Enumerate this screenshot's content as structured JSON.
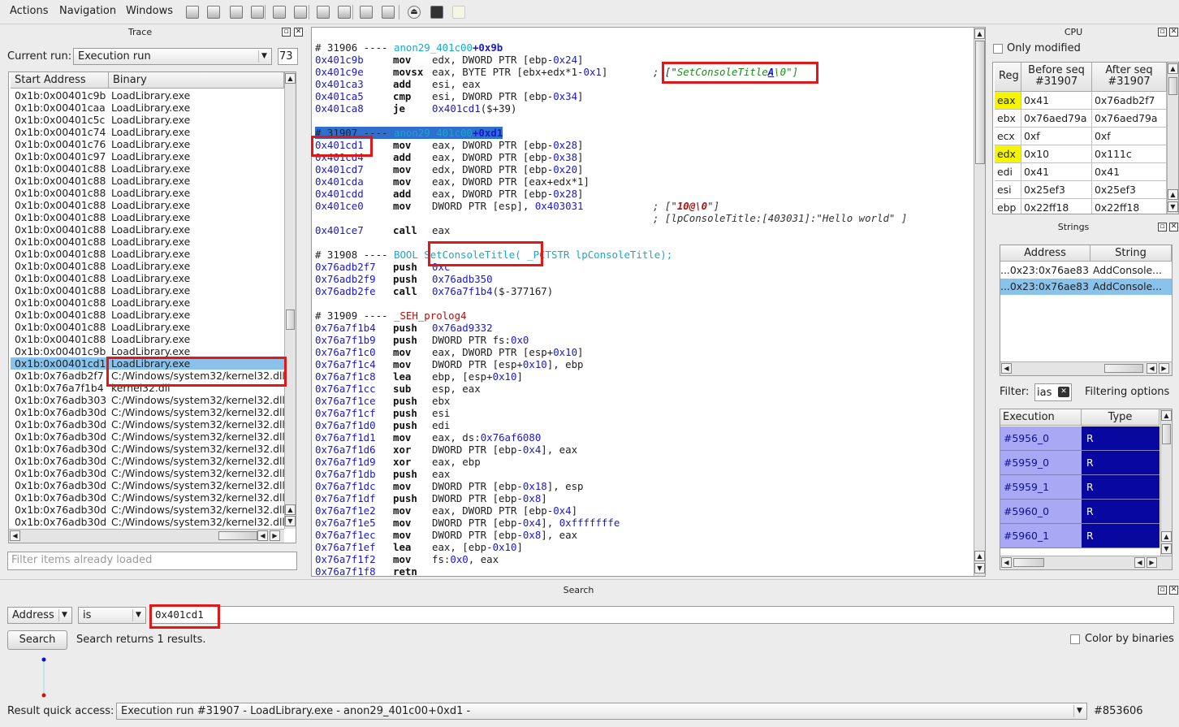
{
  "menu": {
    "actions": "Actions",
    "navigation": "Navigation",
    "windows": "Windows"
  },
  "toolbar_icons": [
    "nav-back-icon",
    "nav-forward-icon",
    "copy-icon",
    "paste-icon",
    "zoom-out-icon",
    "zoom-in-icon",
    "prev-icon",
    "next-icon",
    "bookmark-icon",
    "bookmarks-list-icon",
    "stop-icon",
    "save-icon",
    "clear-icon"
  ],
  "trace": {
    "title": "Trace",
    "current_run_label": "Current run:",
    "current_run_value": "Execution run",
    "run_count": "73",
    "col_start": "Start Address",
    "col_binary": "Binary",
    "filter_placeholder": "Filter items already loaded",
    "rows": [
      [
        "0x1b:0x00401c9b",
        "LoadLibrary.exe"
      ],
      [
        "0x1b:0x00401caa",
        "LoadLibrary.exe"
      ],
      [
        "0x1b:0x00401c5c",
        "LoadLibrary.exe"
      ],
      [
        "0x1b:0x00401c74",
        "LoadLibrary.exe"
      ],
      [
        "0x1b:0x00401c76",
        "LoadLibrary.exe"
      ],
      [
        "0x1b:0x00401c97",
        "LoadLibrary.exe"
      ],
      [
        "0x1b:0x00401c88",
        "LoadLibrary.exe"
      ],
      [
        "0x1b:0x00401c88",
        "LoadLibrary.exe"
      ],
      [
        "0x1b:0x00401c88",
        "LoadLibrary.exe"
      ],
      [
        "0x1b:0x00401c88",
        "LoadLibrary.exe"
      ],
      [
        "0x1b:0x00401c88",
        "LoadLibrary.exe"
      ],
      [
        "0x1b:0x00401c88",
        "LoadLibrary.exe"
      ],
      [
        "0x1b:0x00401c88",
        "LoadLibrary.exe"
      ],
      [
        "0x1b:0x00401c88",
        "LoadLibrary.exe"
      ],
      [
        "0x1b:0x00401c88",
        "LoadLibrary.exe"
      ],
      [
        "0x1b:0x00401c88",
        "LoadLibrary.exe"
      ],
      [
        "0x1b:0x00401c88",
        "LoadLibrary.exe"
      ],
      [
        "0x1b:0x00401c88",
        "LoadLibrary.exe"
      ],
      [
        "0x1b:0x00401c88",
        "LoadLibrary.exe"
      ],
      [
        "0x1b:0x00401c88",
        "LoadLibrary.exe"
      ],
      [
        "0x1b:0x00401c88",
        "LoadLibrary.exe"
      ],
      [
        "0x1b:0x00401c9b",
        "LoadLibrary.exe"
      ],
      [
        "0x1b:0x00401cd1",
        "LoadLibrary.exe"
      ],
      [
        "0x1b:0x76adb2f7",
        "C:/Windows/system32/kernel32.dll"
      ],
      [
        "0x1b:0x76a7f1b4",
        "kernel32.dll"
      ],
      [
        "0x1b:0x76adb303",
        "C:/Windows/system32/kernel32.dll"
      ],
      [
        "0x1b:0x76adb30d",
        "C:/Windows/system32/kernel32.dll"
      ],
      [
        "0x1b:0x76adb30d",
        "C:/Windows/system32/kernel32.dll"
      ],
      [
        "0x1b:0x76adb30d",
        "C:/Windows/system32/kernel32.dll"
      ],
      [
        "0x1b:0x76adb30d",
        "C:/Windows/system32/kernel32.dll"
      ],
      [
        "0x1b:0x76adb30d",
        "C:/Windows/system32/kernel32.dll"
      ],
      [
        "0x1b:0x76adb30d",
        "C:/Windows/system32/kernel32.dll"
      ],
      [
        "0x1b:0x76adb30d",
        "C:/Windows/system32/kernel32.dll"
      ],
      [
        "0x1b:0x76adb30d",
        "C:/Windows/system32/kernel32.dll"
      ],
      [
        "0x1b:0x76adb30d",
        "C:/Windows/system32/kernel32.dll"
      ],
      [
        "0x1b:0x76adb30d",
        "C:/Windows/system32/kernel32.dll"
      ]
    ],
    "selected_row": 22
  },
  "disasm": [
    {
      "t": "h",
      "seq": "# 31906 ---- ",
      "sym": "anon29_401c00",
      "off": "+0x9b"
    },
    {
      "t": "i",
      "a": "0x401c9b",
      "m": "mov",
      "o": "edx, DWORD PTR [ebp-0x24]"
    },
    {
      "t": "i",
      "a": "0x401c9e",
      "m": "movsx",
      "o": "eax, BYTE PTR [ebx+edx*1-0x1]",
      "c1": "; [\"",
      "c2": "SetConsoleTitle",
      "c3": "A",
      "c4": "\\0\"]"
    },
    {
      "t": "i",
      "a": "0x401ca3",
      "m": "add",
      "o": "esi, eax"
    },
    {
      "t": "i",
      "a": "0x401ca5",
      "m": "cmp",
      "o": "esi, DWORD PTR [ebp-0x34]"
    },
    {
      "t": "i",
      "a": "0x401ca8",
      "m": "je",
      "o": "0x401cd1($+39)"
    },
    {
      "t": "b"
    },
    {
      "t": "hs",
      "seq": "# 31907 ---- ",
      "sym": "anon29_401c00",
      "off": "+0xd1"
    },
    {
      "t": "i",
      "a": "0x401cd1",
      "m": "mov",
      "o": "eax, DWORD PTR [ebp-0x28]"
    },
    {
      "t": "i",
      "a": "0x401cd4",
      "m": "add",
      "o": "eax, DWORD PTR [ebp-0x38]"
    },
    {
      "t": "i",
      "a": "0x401cd7",
      "m": "mov",
      "o": "edx, DWORD PTR [ebp-0x20]"
    },
    {
      "t": "i",
      "a": "0x401cda",
      "m": "mov",
      "o": "eax, DWORD PTR [eax+edx*1]"
    },
    {
      "t": "i",
      "a": "0x401cdd",
      "m": "add",
      "o": "eax, DWORD PTR [ebp-0x28]"
    },
    {
      "t": "i",
      "a": "0x401ce0",
      "m": "mov",
      "o": "DWORD PTR [esp], 0x403031",
      "c5": "; [\"",
      "c6": "10@\\0",
      "c7": "\"]"
    },
    {
      "t": "c",
      "c": "; [lpConsoleTitle:[403031]:\"Hello world\" ]"
    },
    {
      "t": "i",
      "a": "0x401ce7",
      "m": "call",
      "o": "eax"
    },
    {
      "t": "b"
    },
    {
      "t": "f",
      "seq": "# 31908 ---- ",
      "ret": "BOOL ",
      "fn": "SetConsoleTitle(",
      "args": " _PCTSTR lpConsoleTitle);"
    },
    {
      "t": "i",
      "a": "0x76adb2f7",
      "m": "push",
      "o": "0xc"
    },
    {
      "t": "i",
      "a": "0x76adb2f9",
      "m": "push",
      "o": "0x76adb350"
    },
    {
      "t": "i",
      "a": "0x76adb2fe",
      "m": "call",
      "o": "0x76a7f1b4($-377167)"
    },
    {
      "t": "b"
    },
    {
      "t": "r",
      "seq": "# 31909 ---- ",
      "fn": "_SEH_prolog4"
    },
    {
      "t": "i",
      "a": "0x76a7f1b4",
      "m": "push",
      "o": "0x76ad9332"
    },
    {
      "t": "i",
      "a": "0x76a7f1b9",
      "m": "push",
      "o": "DWORD PTR fs:0x0"
    },
    {
      "t": "i",
      "a": "0x76a7f1c0",
      "m": "mov",
      "o": "eax, DWORD PTR [esp+0x10]"
    },
    {
      "t": "i",
      "a": "0x76a7f1c4",
      "m": "mov",
      "o": "DWORD PTR [esp+0x10], ebp"
    },
    {
      "t": "i",
      "a": "0x76a7f1c8",
      "m": "lea",
      "o": "ebp, [esp+0x10]"
    },
    {
      "t": "i",
      "a": "0x76a7f1cc",
      "m": "sub",
      "o": "esp, eax"
    },
    {
      "t": "i",
      "a": "0x76a7f1ce",
      "m": "push",
      "o": "ebx"
    },
    {
      "t": "i",
      "a": "0x76a7f1cf",
      "m": "push",
      "o": "esi"
    },
    {
      "t": "i",
      "a": "0x76a7f1d0",
      "m": "push",
      "o": "edi"
    },
    {
      "t": "i",
      "a": "0x76a7f1d1",
      "m": "mov",
      "o": "eax, ds:0x76af6080"
    },
    {
      "t": "i",
      "a": "0x76a7f1d6",
      "m": "xor",
      "o": "DWORD PTR [ebp-0x4], eax"
    },
    {
      "t": "i",
      "a": "0x76a7f1d9",
      "m": "xor",
      "o": "eax, ebp"
    },
    {
      "t": "i",
      "a": "0x76a7f1db",
      "m": "push",
      "o": "eax"
    },
    {
      "t": "i",
      "a": "0x76a7f1dc",
      "m": "mov",
      "o": "DWORD PTR [ebp-0x18], esp"
    },
    {
      "t": "i",
      "a": "0x76a7f1df",
      "m": "push",
      "o": "DWORD PTR [ebp-0x8]"
    },
    {
      "t": "i",
      "a": "0x76a7f1e2",
      "m": "mov",
      "o": "eax, DWORD PTR [ebp-0x4]"
    },
    {
      "t": "i",
      "a": "0x76a7f1e5",
      "m": "mov",
      "o": "DWORD PTR [ebp-0x4], 0xfffffffe"
    },
    {
      "t": "i",
      "a": "0x76a7f1ec",
      "m": "mov",
      "o": "DWORD PTR [ebp-0x8], eax"
    },
    {
      "t": "i",
      "a": "0x76a7f1ef",
      "m": "lea",
      "o": "eax, [ebp-0x10]"
    },
    {
      "t": "i",
      "a": "0x76a7f1f2",
      "m": "mov",
      "o": "fs:0x0, eax"
    },
    {
      "t": "i",
      "a": "0x76a7f1f8",
      "m": "retn",
      "o": ""
    }
  ],
  "cpu": {
    "title": "CPU",
    "only_modified": "Only modified",
    "col_reg": "Reg",
    "col_before": "Before seq\n#31907",
    "col_after": "After seq\n#31907",
    "rows": [
      {
        "reg": "eax",
        "before": "0x41",
        "after": "0x76adb2f7",
        "changed": true
      },
      {
        "reg": "ebx",
        "before": "0x76aed79a",
        "after": "0x76aed79a",
        "changed": false
      },
      {
        "reg": "ecx",
        "before": "0xf",
        "after": "0xf",
        "changed": false
      },
      {
        "reg": "edx",
        "before": "0x10",
        "after": "0x111c",
        "changed": true
      },
      {
        "reg": "edi",
        "before": "0x41",
        "after": "0x41",
        "changed": false
      },
      {
        "reg": "esi",
        "before": "0x25ef3",
        "after": "0x25ef3",
        "changed": false
      },
      {
        "reg": "ebp",
        "before": "0x22ff18",
        "after": "0x22ff18",
        "changed": false
      }
    ]
  },
  "strings": {
    "title": "Strings",
    "col_address": "Address",
    "col_string": "String",
    "rows": [
      {
        "address": "0x23:0x76ae83...",
        "string": "AddConsole..."
      },
      {
        "address": "0x23:0x76ae83...",
        "string": "AddConsole..."
      }
    ],
    "filter_label": "Filter:",
    "filter_value": "ias",
    "filtering_options": "Filtering options",
    "col_exec": "Execution point",
    "col_type": "Type",
    "exec_rows": [
      {
        "point": "#5956_0",
        "type": "R"
      },
      {
        "point": "#5959_0",
        "type": "R"
      },
      {
        "point": "#5959_1",
        "type": "R"
      },
      {
        "point": "#5960_0",
        "type": "R"
      },
      {
        "point": "#5960_1",
        "type": "R"
      }
    ]
  },
  "search": {
    "title": "Search",
    "field": "Address",
    "op": "is",
    "value": "0x401cd1",
    "button": "Search",
    "result_text": "Search returns 1 results.",
    "color_by_binaries": "Color by binaries",
    "quick_label": "Result quick access:",
    "quick_value": "Execution run #31907 - LoadLibrary.exe - anon29_401c00+0xd1 -",
    "count": "#853606"
  }
}
